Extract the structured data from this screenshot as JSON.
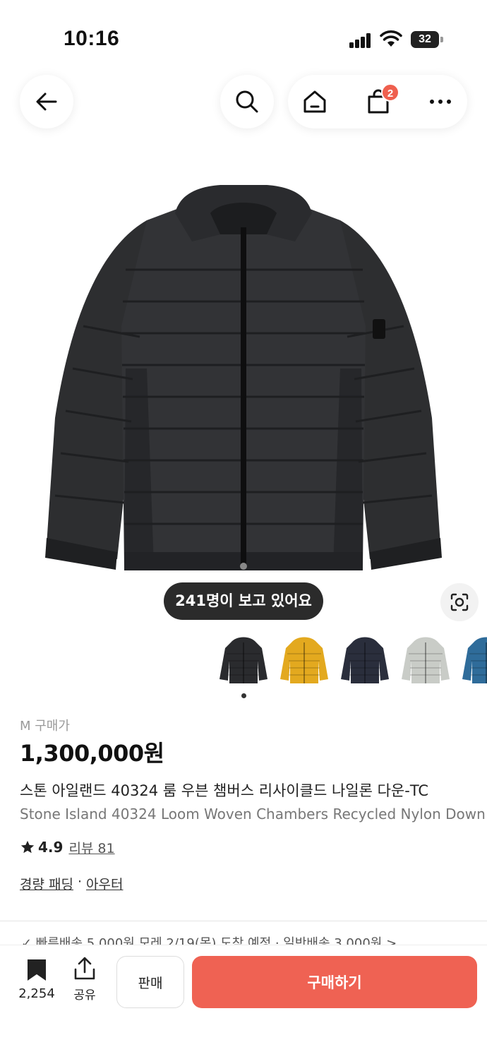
{
  "status_bar": {
    "time": "10:16",
    "battery": "32"
  },
  "nav": {
    "back_icon": "arrow-left-icon",
    "search_icon": "search-icon",
    "home_icon": "home-icon",
    "cart_icon": "shopping-bag-icon",
    "cart_badge": "2",
    "more_icon": "more-horizontal-icon"
  },
  "product": {
    "viewers_text": "241명이 보고 있어요",
    "variant_colors": [
      "#2a2b2e",
      "#e3a91f",
      "#2a2e3c",
      "#c9ccc7",
      "#2f6c9a"
    ],
    "selected_variant_index": 0,
    "size_label": "M 구매가",
    "price": "1,300,000원",
    "name_ko": "스톤 아일랜드 40324 룸 우븐 챔버스 리사이클드 나일론 다운-TC",
    "name_en": "Stone Island 40324 Loom Woven Chambers Recycled Nylon Down",
    "rating": "4.9",
    "reviews_label": "리뷰 81",
    "category": [
      "경량 패딩",
      "아우터"
    ],
    "category_sep": "·",
    "shipping_text": "✓ 빠른배송 5,000원 모레 2/19(목) 도착 예정 · 일반배송 3,000원 >"
  },
  "bottom_bar": {
    "save_count": "2,254",
    "share_label": "공유",
    "sell_label": "판매",
    "buy_label": "구매하기"
  },
  "colors": {
    "accent": "#ef6253",
    "badge": "#ef5f4e"
  }
}
